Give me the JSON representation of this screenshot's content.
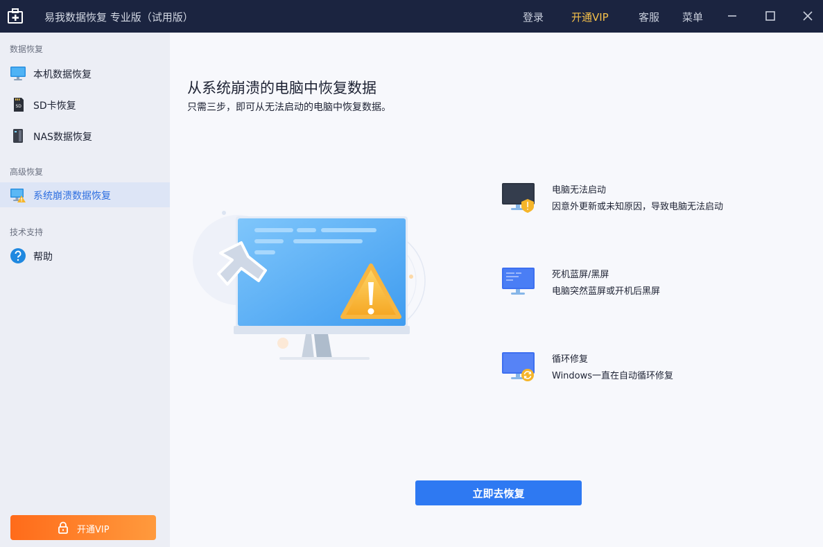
{
  "titlebar": {
    "app_title": "易我数据恢复 专业版（试用版）",
    "login": "登录",
    "vip": "开通VIP",
    "service": "客服",
    "menu": "菜单",
    "icons": [
      "app-logo-icon",
      "minimize-icon",
      "maximize-icon",
      "close-icon"
    ]
  },
  "sidebar": {
    "sections": [
      {
        "label": "数据恢复"
      },
      {
        "label": "高级恢复"
      },
      {
        "label": "技术支持"
      }
    ],
    "items": [
      {
        "label": "本机数据恢复",
        "icon": "monitor-icon"
      },
      {
        "label": "SD卡恢复",
        "icon": "sd-card-icon"
      },
      {
        "label": "NAS数据恢复",
        "icon": "nas-icon"
      },
      {
        "label": "系统崩溃数据恢复",
        "icon": "crash-monitor-icon",
        "active": true
      },
      {
        "label": "帮助",
        "icon": "help-icon"
      }
    ],
    "vip_button": "开通VIP"
  },
  "main": {
    "title": "从系统崩溃的电脑中恢复数据",
    "subtitle": "只需三步，即可从无法启动的电脑中恢复数据。",
    "features": [
      {
        "title": "电脑无法启动",
        "desc": "因意外更新或未知原因，导致电脑无法启动",
        "icon": "monitor-warning-icon"
      },
      {
        "title": "死机蓝屏/黑屏",
        "desc": "电脑突然蓝屏或开机后黑屏",
        "icon": "blue-screen-icon"
      },
      {
        "title": "循环修复",
        "desc": "Windows一直在自动循环修复",
        "icon": "loop-repair-icon"
      }
    ],
    "recover_button": "立即去恢复"
  },
  "colors": {
    "titlebar_bg": "#1b2440",
    "vip_gold": "#f5c04a",
    "accent_blue": "#2e79f2",
    "active_item_text": "#2d6ee0",
    "vip_orange": "#ff7a25"
  }
}
